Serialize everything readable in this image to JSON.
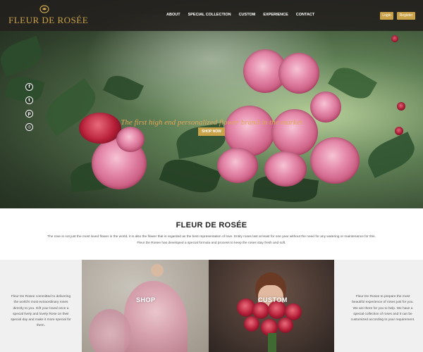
{
  "brand": {
    "name": "FLEUR DE ROSÉE",
    "gold": "#c9a24a",
    "logo_icon": "rose-icon"
  },
  "nav": {
    "links": [
      "ABOUT",
      "SPECIAL COLLECTION",
      "CUSTOM",
      "EXPERIENCE",
      "CONTACT"
    ],
    "login": "Login",
    "register": "Register"
  },
  "social": [
    "facebook-icon",
    "twitter-icon",
    "pinterest-icon",
    "instagram-icon"
  ],
  "hero": {
    "tagline": "The first high end personalized flower brand in the market",
    "cta": "SHOP NOW"
  },
  "about": {
    "title": "FLEUR DE ROSÉE",
    "text_line1": "The rose is not just the most loved flower in the world, it is also the flower that is regarded as the best representation of love. Entity roses last at least for one year without the need for any watering or maintenance for this.",
    "text_line2": "Fleur De Rosee has developed a special formula and process to keep the roses stay fresh and soft."
  },
  "panels": {
    "left_text": "Fleur De Rosee committed to delivering the world's most extraordinary roses directly to you. Gift your loved once a special lively and lovely Rose on their special day and make it more special for them.",
    "shop_label": "SHOP",
    "custom_label": "CUSTOM",
    "right_text": "Fleur De Rosee to prepare the most beautiful experience of roses just for you. We are there for you to help. We have a special collection of roses and it can be customized according to your requirement."
  }
}
